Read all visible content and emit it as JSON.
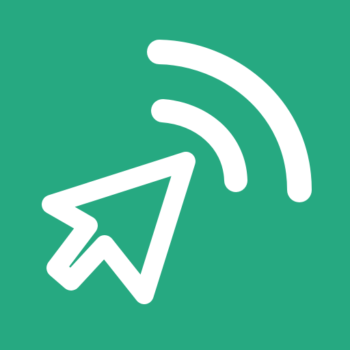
{
  "app_icon": {
    "background_color": "#26a981",
    "foreground_color": "#ffffff",
    "icons": [
      "cursor-icon",
      "signal-wave-icon"
    ]
  }
}
